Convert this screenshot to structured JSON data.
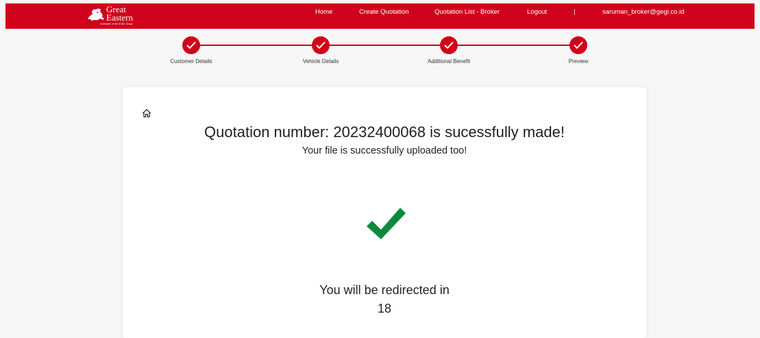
{
  "colors": {
    "brand": "#d0021b",
    "success": "#0b8a3c",
    "card": "#ffffff"
  },
  "header": {
    "logo": {
      "line1": "Great",
      "line2": "Eastern",
      "tagline": "A member of the OCBC Group",
      "icon": "lion-logo-icon"
    },
    "nav": {
      "home": "Home",
      "create_quotation": "Create Quotation",
      "quotation_list": "Quotation List - Broker",
      "logout": "Logout",
      "separator": "|",
      "user_email": "saruman_broker@gegi.co.id"
    }
  },
  "stepper": {
    "steps": [
      {
        "label": "Customer Details",
        "state": "completed"
      },
      {
        "label": "Vehicle Details",
        "state": "completed"
      },
      {
        "label": "Additional Benefit",
        "state": "completed"
      },
      {
        "label": "Preview",
        "state": "completed"
      }
    ]
  },
  "card": {
    "home_icon": "home-icon",
    "title": "Quotation number: 20232400068 is sucessfully made!",
    "subtitle": "Your file is successfully uploaded too!",
    "success_icon": "checkmark-icon",
    "redirect_text": "You will be redirected in",
    "countdown": "18"
  }
}
